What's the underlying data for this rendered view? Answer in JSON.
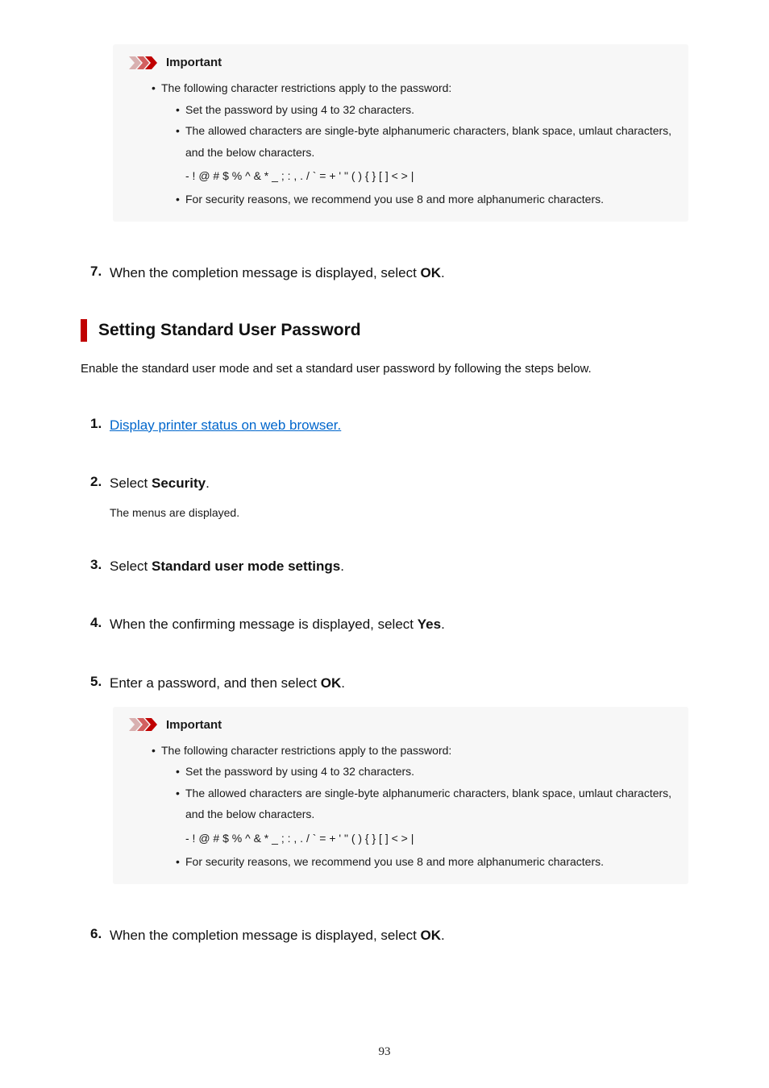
{
  "important_label": "Important",
  "callout1": {
    "intro": "The following character restrictions apply to the password:",
    "b1": "Set the password by using 4 to 32 characters.",
    "b2": "The allowed characters are single-byte alphanumeric characters, blank space, umlaut characters, and the below characters.",
    "chars": "- ! @ # $ % ^ & * _ ; : , . / ` = + ' \" ( ) { } [ ] < > |",
    "b3": "For security reasons, we recommend you use 8 and more alphanumeric characters."
  },
  "step7": {
    "num": "7.",
    "text_pre": "When the completion message is displayed, select ",
    "text_bold": "OK",
    "text_post": "."
  },
  "section": {
    "title": "Setting Standard User Password",
    "intro": "Enable the standard user mode and set a standard user password by following the steps below."
  },
  "step1": {
    "num": "1.",
    "link": "Display printer status on web browser."
  },
  "step2": {
    "num": "2.",
    "text_pre": "Select ",
    "text_bold": "Security",
    "text_post": ".",
    "sub": "The menus are displayed."
  },
  "step3": {
    "num": "3.",
    "text_pre": "Select ",
    "text_bold": "Standard user mode settings",
    "text_post": "."
  },
  "step4": {
    "num": "4.",
    "text_pre": "When the confirming message is displayed, select ",
    "text_bold": "Yes",
    "text_post": "."
  },
  "step5": {
    "num": "5.",
    "text_pre": "Enter a password, and then select ",
    "text_bold": "OK",
    "text_post": "."
  },
  "callout2": {
    "intro": "The following character restrictions apply to the password:",
    "b1": "Set the password by using 4 to 32 characters.",
    "b2": "The allowed characters are single-byte alphanumeric characters, blank space, umlaut characters, and the below characters.",
    "chars": "- ! @ # $ % ^ & * _ ; : , . / ` = + ' \" ( ) { } [ ] < > |",
    "b3": "For security reasons, we recommend you use 8 and more alphanumeric characters."
  },
  "step6": {
    "num": "6.",
    "text_pre": "When the completion message is displayed, select ",
    "text_bold": "OK",
    "text_post": "."
  },
  "page_number": "93"
}
